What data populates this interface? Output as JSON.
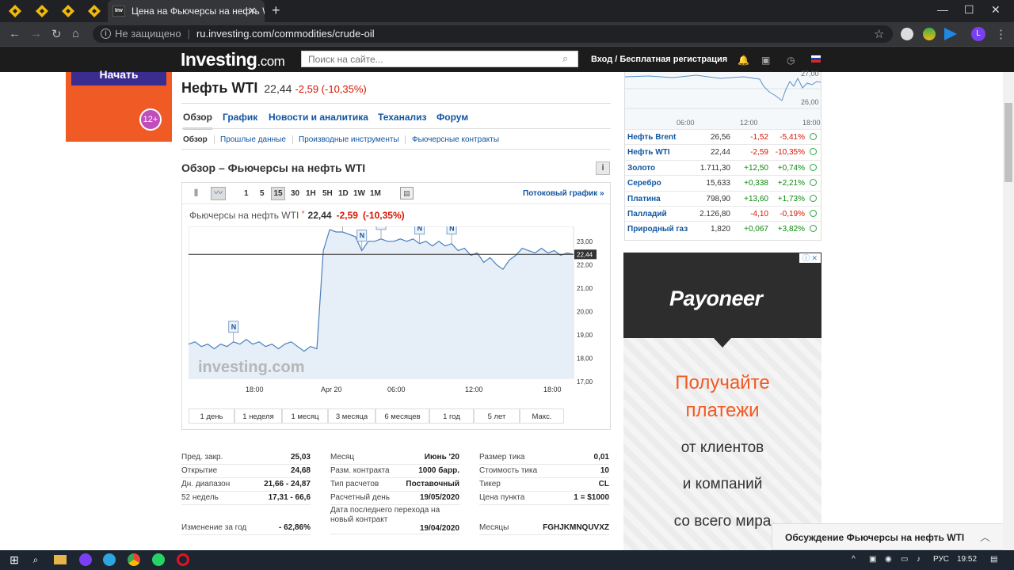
{
  "browser": {
    "tab_title": "Цена на Фьючерсы на нефть WTI",
    "tab_favicon_text": "Inv",
    "address_security": "Не защищено",
    "address_url": "ru.investing.com/commodities/crude-oil",
    "avatar_letter": "L"
  },
  "site": {
    "logo_main": "Investing",
    "logo_suffix": ".com",
    "search_placeholder": "Поиск на сайте...",
    "login_text": "Вход / Бесплатная регистрация"
  },
  "left_ad": {
    "button_text": "Начать",
    "age_badge": "12+"
  },
  "instrument": {
    "title": "Нефть WTI",
    "price": "22,44",
    "change": "-2,59 (-10,35%)"
  },
  "main_tabs": [
    "Обзор",
    "График",
    "Новости и аналитика",
    "Теханализ",
    "Форум"
  ],
  "sub_tabs": [
    "Обзор",
    "Прошлые данные",
    "Производные инструменты",
    "Фьючерсные контракты"
  ],
  "overview_title": "Обзор – Фьючерсы на нефть WTI",
  "chart_toolbar": {
    "intervals": [
      "1",
      "5",
      "15",
      "30",
      "1H",
      "5H",
      "1D",
      "1W",
      "1M"
    ],
    "selected": "15",
    "stream_link": "Потоковый график »"
  },
  "chart_header": {
    "name": "Фьючерсы на нефть WTI",
    "price": "22,44",
    "change": "-2,59",
    "change_pct": "(-10,35%)"
  },
  "chart_data": {
    "type": "area",
    "x_tick_labels": [
      "18:00",
      "Apr 20",
      "06:00",
      "12:00",
      "18:00"
    ],
    "y_tick_labels": [
      "23,00",
      "22,00",
      "21,00",
      "20,00",
      "19,00",
      "18,00",
      "17,00"
    ],
    "ylim": [
      17,
      23.5
    ],
    "last_price_label": "22,44",
    "last_price": 22.44,
    "watermark": "investing.com",
    "news_marker_label": "N",
    "series": [
      {
        "values": [
          18.6,
          18.7,
          18.5,
          18.6,
          18.4,
          18.6,
          18.5,
          18.7,
          18.6,
          18.8,
          18.6,
          18.7,
          18.5,
          18.6,
          18.4,
          18.6,
          18.7,
          18.5,
          18.3,
          18.5,
          18.4,
          22.6,
          23.5,
          23.4,
          23.4,
          23.3,
          23.2,
          22.6,
          23.0,
          23.0,
          23.1,
          23.0,
          23.0,
          23.1,
          23.0,
          23.1,
          22.9,
          23.0,
          22.8,
          23.0,
          22.8,
          22.9,
          22.6,
          22.7,
          22.4,
          22.5,
          22.1,
          22.3,
          22.0,
          21.8,
          22.2,
          22.4,
          22.7,
          22.6,
          22.5,
          22.7,
          22.5,
          22.6,
          22.4,
          22.5,
          22.44
        ]
      }
    ],
    "news_markers": [
      7,
      24,
      27,
      30,
      36,
      41
    ]
  },
  "range_buttons": [
    "1 день",
    "1 неделя",
    "1 месяц",
    "3 месяца",
    "6 месяцев",
    "1 год",
    "5 лет",
    "Макс."
  ],
  "stats": {
    "col1": [
      {
        "label": "Пред. закр.",
        "value": "25,03"
      },
      {
        "label": "Открытие",
        "value": "24,68"
      },
      {
        "label": "Дн. диапазон",
        "value": "21,66 - 24,87"
      },
      {
        "label": "52 недель",
        "value": "17,31 - 66,6"
      },
      {
        "label": "Изменение за год",
        "value": "- 62,86%"
      }
    ],
    "col2": [
      {
        "label": "Месяц",
        "value": "Июнь '20"
      },
      {
        "label": "Разм. контракта",
        "value": "1000 барр."
      },
      {
        "label": "Тип расчетов",
        "value": "Поставочный"
      },
      {
        "label": "Расчетный день",
        "value": "19/05/2020"
      },
      {
        "label": "Дата последнего перехода на новый контракт",
        "value": "19/04/2020"
      }
    ],
    "col3": [
      {
        "label": "Размер тика",
        "value": "0,01"
      },
      {
        "label": "Стоимость тика",
        "value": "10"
      },
      {
        "label": "Тикер",
        "value": "CL"
      },
      {
        "label": "Цена пункта",
        "value": "1 = $1000"
      },
      {
        "label": "Месяцы",
        "value": "FGHJKMNQUVXZ"
      }
    ]
  },
  "mini_chart": {
    "y_labels": [
      "27,00",
      "26,00"
    ],
    "x_labels": [
      "06:00",
      "12:00",
      "18:00"
    ]
  },
  "quotes": [
    {
      "name": "Нефть Brent",
      "price": "26,56",
      "change": "-1,52",
      "pct": "-5,41%",
      "dir": "neg"
    },
    {
      "name": "Нефть WTI",
      "price": "22,44",
      "change": "-2,59",
      "pct": "-10,35%",
      "dir": "neg"
    },
    {
      "name": "Золото",
      "price": "1.711,30",
      "change": "+12,50",
      "pct": "+0,74%",
      "dir": "pos"
    },
    {
      "name": "Серебро",
      "price": "15,633",
      "change": "+0,338",
      "pct": "+2,21%",
      "dir": "pos"
    },
    {
      "name": "Платина",
      "price": "798,90",
      "change": "+13,60",
      "pct": "+1,73%",
      "dir": "pos"
    },
    {
      "name": "Палладий",
      "price": "2.126,80",
      "change": "-4,10",
      "pct": "-0,19%",
      "dir": "neg"
    },
    {
      "name": "Природный газ",
      "price": "1,820",
      "change": "+0,067",
      "pct": "+3,82%",
      "dir": "pos"
    }
  ],
  "right_ad": {
    "logo": "Payoneer",
    "lines": [
      "Получайте",
      "платежи",
      "от клиентов",
      "и компаний",
      "со всего мира"
    ]
  },
  "discussion_bar": "Обсуждение Фьючерсы на нефть WTI",
  "taskbar": {
    "lang": "РУС",
    "time": "19:52"
  },
  "colors": {
    "negative": "#d91400",
    "positive": "#0a8a0a",
    "link": "#1256a0",
    "payoneer_accent": "#f05a24"
  }
}
